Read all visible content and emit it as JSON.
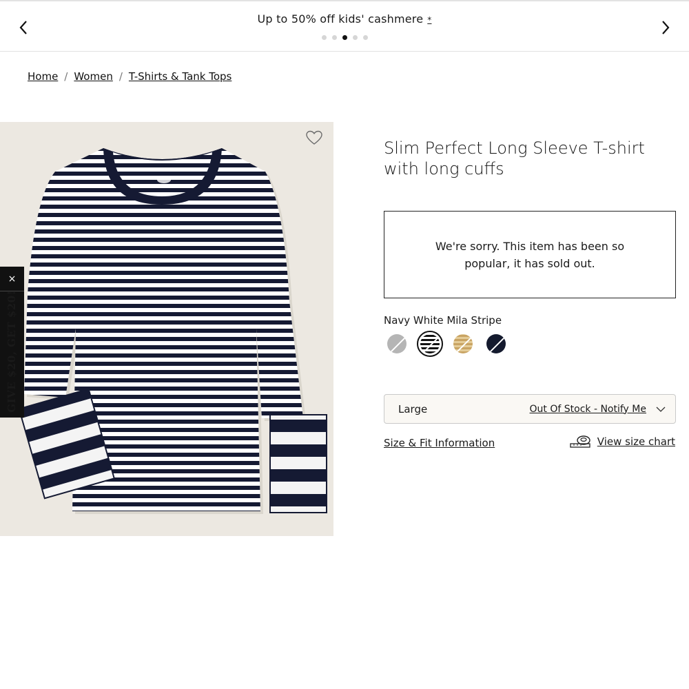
{
  "promo": {
    "text": "Up to 50% off kids' cashmere",
    "marker": "*",
    "slides_total": 5,
    "active_slide": 3
  },
  "breadcrumb": {
    "items": [
      "Home",
      "Women",
      "T-Shirts & Tank Tops"
    ],
    "separator": "/"
  },
  "side_promo": {
    "close_label": "×",
    "text": "GIVE $20, GET $20!"
  },
  "product": {
    "title": "Slim Perfect Long Sleeve T-shirt with long cuffs",
    "sold_out_message": "We're sorry. This item has been so popular, it has sold out.",
    "color_name": "Navy White Mila Stripe",
    "swatches": [
      {
        "name": "grey",
        "color": "#b5b5b5",
        "selected": false
      },
      {
        "name": "navy-white-stripe",
        "color": "#111111",
        "selected": true
      },
      {
        "name": "gold-stripe",
        "color": "#c9a463",
        "selected": false
      },
      {
        "name": "navy",
        "color": "#141a2e",
        "selected": false
      }
    ],
    "size": {
      "selected": "Large",
      "status": "Out Of Stock - Notify Me"
    },
    "size_fit_link": "Size & Fit Information",
    "size_chart_link": "View size chart"
  },
  "colors": {
    "navy": "#151a33",
    "image_bg": "#ece8e1",
    "select_bg": "#faf8f4"
  }
}
